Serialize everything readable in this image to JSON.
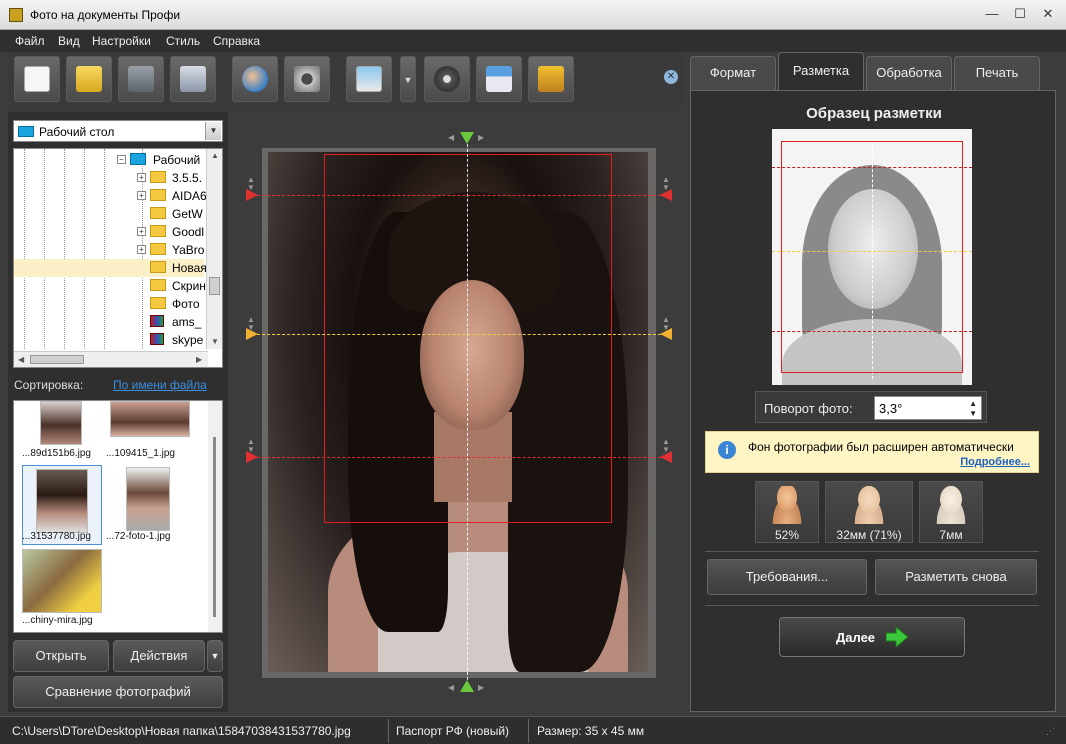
{
  "window": {
    "title": "Фото на документы Профи",
    "minimize": "—",
    "maximize": "☐",
    "close": "✕"
  },
  "menu": [
    "Файл",
    "Вид",
    "Настройки",
    "Стиль",
    "Справка"
  ],
  "toolbar": {
    "buttons": [
      "new-document-icon",
      "open-folder-icon",
      "save-icon",
      "print-icon",
      "user-search-icon",
      "camera-icon",
      "photo-edit-icon",
      "film-reel-icon",
      "home-icon",
      "shopping-cart-icon"
    ],
    "dropdown_arrow": "▼",
    "close_glyph": "✕"
  },
  "browser": {
    "location": "Рабочий стол",
    "tree": [
      {
        "label": "Рабочий",
        "expander": "−",
        "type": "desktop"
      },
      {
        "label": "3.5.5.",
        "expander": "+",
        "type": "folder"
      },
      {
        "label": "AIDA6",
        "expander": "+",
        "type": "folder"
      },
      {
        "label": "GetW",
        "expander": "",
        "type": "folder"
      },
      {
        "label": "Goodl",
        "expander": "+",
        "type": "folder"
      },
      {
        "label": "YaBro",
        "expander": "+",
        "type": "folder"
      },
      {
        "label": "Новая",
        "expander": "",
        "type": "folder",
        "selected": true
      },
      {
        "label": "Скрин",
        "expander": "",
        "type": "folder"
      },
      {
        "label": "Фото",
        "expander": "",
        "type": "folder"
      },
      {
        "label": "ams_",
        "expander": "",
        "type": "archive"
      },
      {
        "label": "skype",
        "expander": "",
        "type": "archive"
      }
    ],
    "sort_label": "Сортировка:",
    "sort_value": "По имени файла"
  },
  "thumbnails": [
    {
      "caption": "...89d151b6.jpg"
    },
    {
      "caption": "...109415_1.jpg"
    },
    {
      "caption": "...31537780.jpg",
      "selected": true
    },
    {
      "caption": "...72-foto-1.jpg"
    },
    {
      "caption": "...chiny-mira.jpg"
    }
  ],
  "left_buttons": {
    "open": "Открыть",
    "actions": "Действия",
    "actions_arrow": "▼",
    "compare": "Сравнение фотографий"
  },
  "tabs": [
    {
      "label": "Формат",
      "active": false
    },
    {
      "label": "Разметка",
      "active": true
    },
    {
      "label": "Обработка",
      "active": false
    },
    {
      "label": "Печать",
      "active": false
    }
  ],
  "markup_panel": {
    "title": "Образец разметки",
    "rotation_label": "Поворот фото:",
    "rotation_value": "3,3°",
    "info_text": "Фон фотографии был расширен автоматически",
    "info_link": "Подробнее...",
    "metrics": [
      {
        "icon": "head-size-icon",
        "value": "52%"
      },
      {
        "icon": "face-height-icon",
        "value": "32мм (71%)"
      },
      {
        "icon": "head-top-margin-icon",
        "value": "7мм"
      }
    ],
    "requirements_button": "Требования...",
    "remark_button": "Разметить снова",
    "next_button": "Далее"
  },
  "colors": {
    "accent_red": "#e02020",
    "guide_yellow": "#f0d040",
    "next_arrow": "#3cc83c",
    "link": "#3b8fe0"
  },
  "status": {
    "path": "C:\\Users\\DTore\\Desktop\\Новая папка\\15847038431537780.jpg",
    "format": "Паспорт РФ (новый)",
    "size": "Размер: 35 х 45 мм"
  }
}
